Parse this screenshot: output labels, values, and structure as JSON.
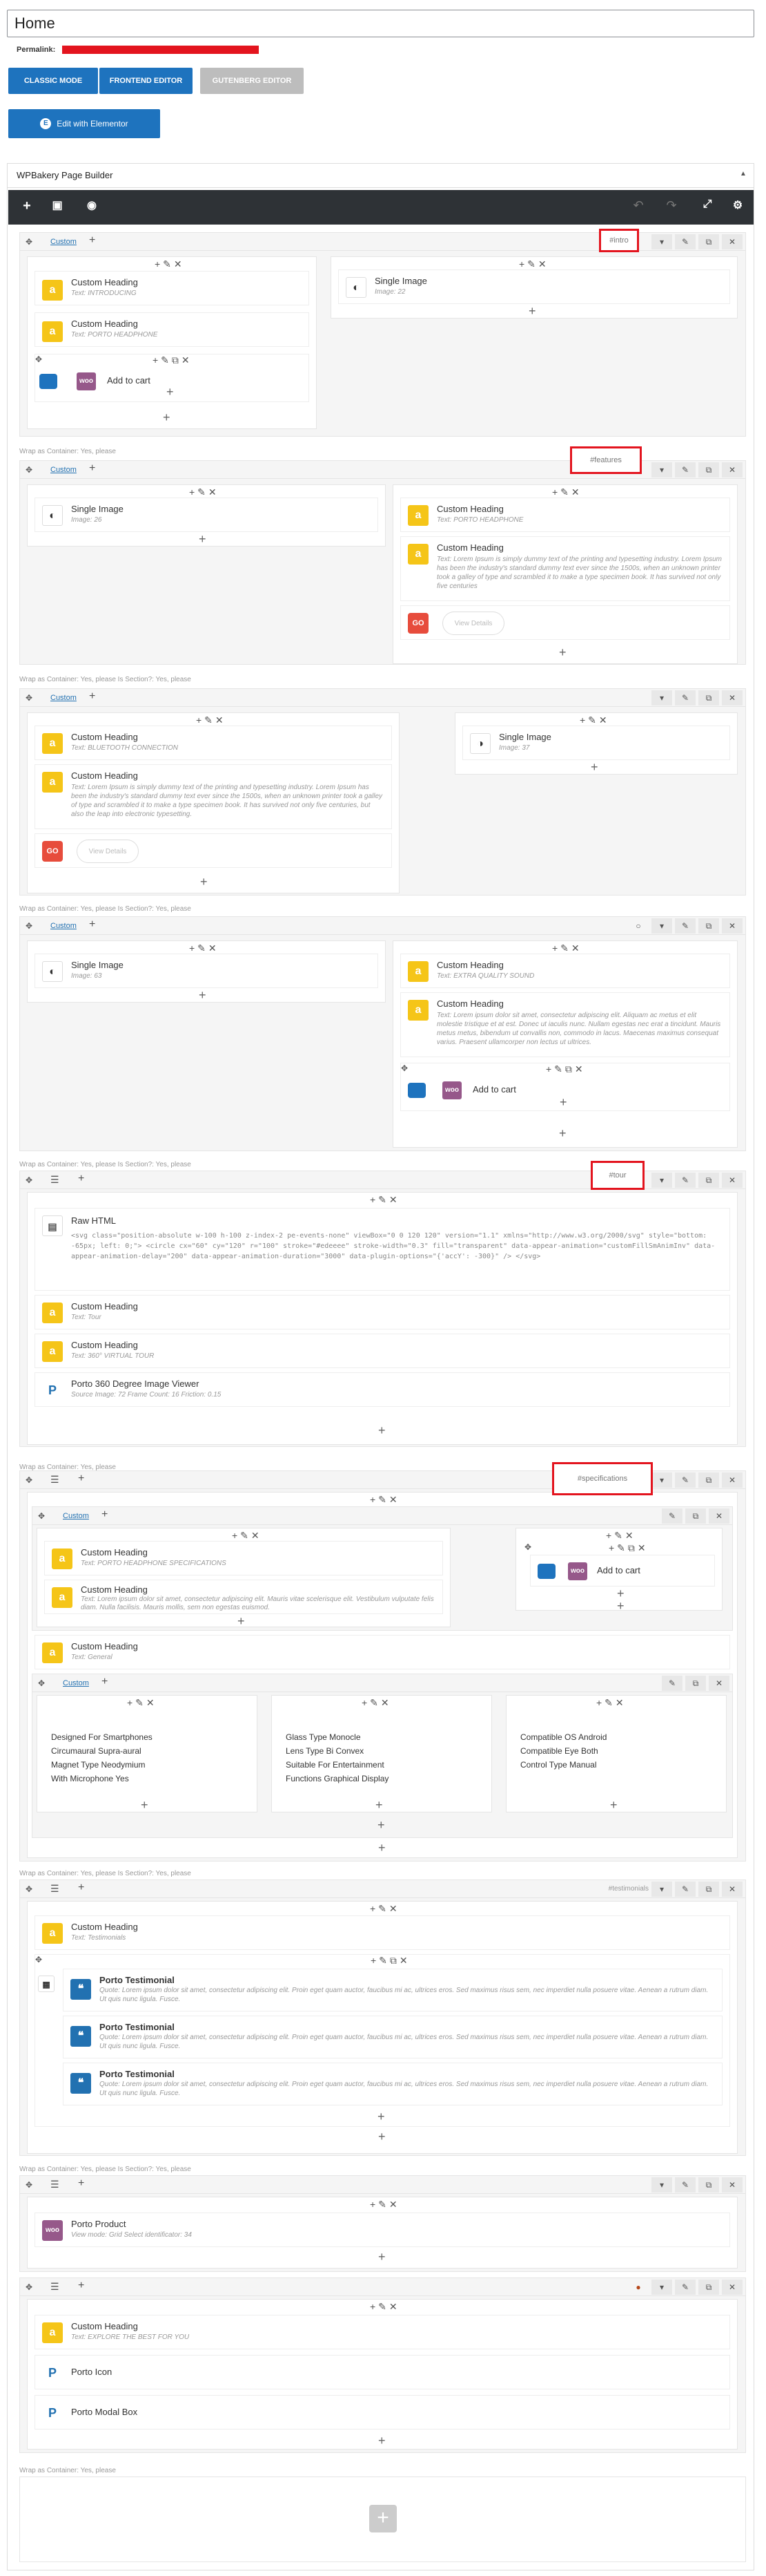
{
  "page": {
    "title": "Home",
    "permalink_label": "Permalink:"
  },
  "modes": {
    "classic": "CLASSIC MODE",
    "frontend": "FRONTEND EDITOR",
    "gutenberg": "GUTENBERG EDITOR",
    "elementor": "Edit with Elementor"
  },
  "builder": {
    "title": "WPBakery Page Builder"
  },
  "labels": {
    "custom": "Custom",
    "wrap_container": "Wrap as Container: Yes, please",
    "wrap_container_section": "Wrap as Container: Yes, please  Is Section?: Yes, please",
    "custom_heading": "Custom Heading",
    "single_image": "Single Image",
    "add_to_cart": "Add to cart",
    "go": "GO",
    "view_more": "View Details",
    "woo": "woo"
  },
  "rows": {
    "intro": {
      "id_label": "#intro",
      "left": [
        {
          "title": "Custom Heading",
          "sub": "Text: INTRODUCING"
        },
        {
          "title": "Custom Heading",
          "sub": "Text: PORTO HEADPHONE"
        }
      ],
      "right": {
        "title": "Single Image",
        "sub": "Image: 22"
      }
    },
    "features": {
      "id_label": "#features",
      "left": {
        "title": "Single Image",
        "sub": "Image: 26"
      },
      "right": {
        "title": "Custom Heading",
        "sub": "Text: PORTO HEADPHONE"
      },
      "heading2": "Custom Heading",
      "text": "Text: Lorem Ipsum is simply dummy text of the printing and typesetting industry. Lorem Ipsum has been the industry's standard dummy text ever since the 1500s, when an unknown printer took a galley of type and scrambled it to make a type specimen book. It has survived not only five centuries"
    },
    "bluetooth": {
      "h1": {
        "title": "Custom Heading",
        "sub": "Text: BLUETOOTH CONNECTION"
      },
      "h2": "Custom Heading",
      "text": "Text: Lorem Ipsum is simply dummy text of the printing and typesetting industry. Lorem Ipsum has been the industry's standard dummy text ever since the 1500s, when an unknown printer took a galley of type and scrambled it to make a type specimen book. It has survived not only five centuries, but also the leap into electronic typesetting.",
      "right": {
        "title": "Single Image",
        "sub": "Image: 37"
      }
    },
    "sound": {
      "left": {
        "title": "Single Image",
        "sub": "Image: 63"
      },
      "h1": {
        "title": "Custom Heading",
        "sub": "Text: EXTRA QUALITY SOUND"
      },
      "h2": "Custom Heading",
      "text": "Text: Lorem ipsum dolor sit amet, consectetur adipiscing elit. Aliquam ac metus et elit molestie tristique et at est. Donec ut iaculis nunc. Nullam egestas nec erat a tincidunt. Mauris metus metus, bibendum ut convallis non, commodo in lacus. Maecenas maximus consequat varius. Praesent ullamcorper non lectus ut ultrices."
    },
    "tour": {
      "id_label": "#tour",
      "raw_title": "Raw HTML",
      "raw_code": "<svg class=\"position-absolute w-100 h-100 z-index-2 pe-events-none\" viewBox=\"0 0 120 120\" version=\"1.1\" xmlns=\"http://www.w3.org/2000/svg\" style=\"bottom: -65px; left: 0;\"> <circle cx=\"60\" cy=\"120\" r=\"100\" stroke=\"#edeeee\" stroke-width=\"0.3\" fill=\"transparent\" data-appear-animation=\"customFillSmAnimInv\" data-appear-animation-delay=\"200\" data-appear-animation-duration=\"3000\" data-plugin-options=\"{'accY': -300}\" /> </svg>",
      "h1": {
        "title": "Custom Heading",
        "sub": "Text: Tour"
      },
      "h2": {
        "title": "Custom Heading",
        "sub": "Text: 360° VIRTUAL TOUR"
      },
      "viewer": {
        "title": "Porto 360 Degree Image Viewer",
        "sub": "Source Image: 72  Frame Count: 16  Friction: 0.15"
      }
    },
    "specs": {
      "id_label": "#specifications",
      "h1": {
        "title": "Custom Heading",
        "sub": "Text: PORTO HEADPHONE SPECIFICATIONS"
      },
      "h2": "Custom Heading",
      "h2_text": "Text: Lorem ipsum dolor sit amet, consectetur adipiscing elit. Mauris vitae scelerisque elit. Vestibulum vulputate felis diam. Nulla facilisis. Mauris mollis, sem non egestas euismod.",
      "h3": {
        "title": "Custom Heading",
        "sub": "Text: General"
      },
      "col1": [
        "Designed For Smartphones",
        "Circumaural Supra-aural",
        "Magnet Type Neodymium",
        "With Microphone Yes"
      ],
      "col2": [
        "Glass Type Monocle",
        "Lens Type Bi Convex",
        "Suitable For Entertainment",
        "Functions Graphical Display"
      ],
      "col3": [
        "Compatible OS Android",
        "Compatible Eye Both",
        "Control Type Manual"
      ]
    },
    "testimonials": {
      "id_label": "#testimonials",
      "h1": {
        "title": "Custom Heading",
        "sub": "Text: Testimonials"
      },
      "items": [
        {
          "title": "Porto Testimonial",
          "sub": "Quote: Lorem ipsum dolor sit amet, consectetur adipiscing elit. Proin eget quam auctor, faucibus mi ac, ultrices eros. Sed maximus risus sem, nec imperdiet nulla posuere vitae. Aenean a rutrum diam. Ut quis nunc ligula. Fusce."
        },
        {
          "title": "Porto Testimonial",
          "sub": "Quote: Lorem ipsum dolor sit amet, consectetur adipiscing elit. Proin eget quam auctor, faucibus mi ac, ultrices eros. Sed maximus risus sem, nec imperdiet nulla posuere vitae. Aenean a rutrum diam. Ut quis nunc ligula. Fusce."
        },
        {
          "title": "Porto Testimonial",
          "sub": "Quote: Lorem ipsum dolor sit amet, consectetur adipiscing elit. Proin eget quam auctor, faucibus mi ac, ultrices eros. Sed maximus risus sem, nec imperdiet nulla posuere vitae. Aenean a rutrum diam. Ut quis nunc ligula. Fusce."
        }
      ]
    },
    "product": {
      "title": "Porto Product",
      "sub": "View mode: Grid  Select identificator: 34"
    },
    "explore": {
      "h1": {
        "title": "Custom Heading",
        "sub": "Text: EXPLORE THE BEST FOR YOU"
      },
      "icon": "Porto Icon",
      "modal": "Porto Modal Box"
    }
  },
  "colors": {
    "accent": "#1e73be",
    "highlight": "#e3141e",
    "heading_icon": "#f5c518",
    "toolbar": "#2e3236"
  }
}
